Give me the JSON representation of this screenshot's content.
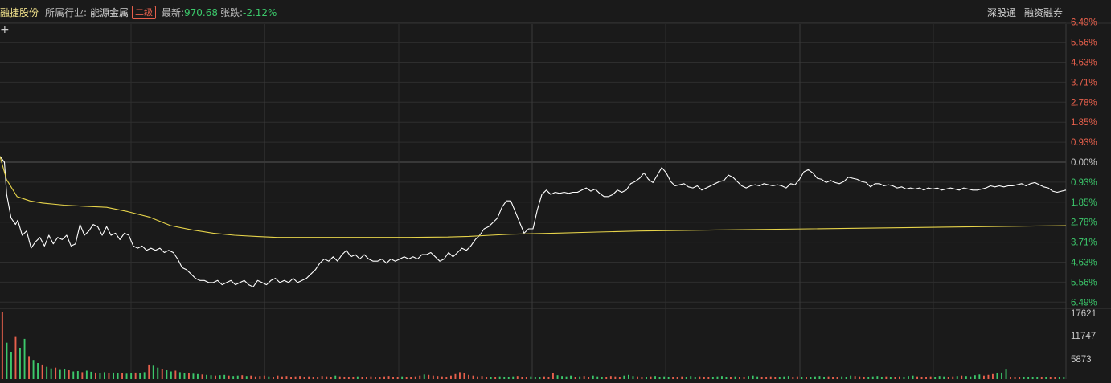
{
  "header": {
    "stock_name": "融捷股份",
    "industry_label": "所属行业:",
    "industry_value": "能源金属",
    "level_badge": "二级",
    "latest_label": "最新:",
    "latest_value": "970.68",
    "change_label": "张跌:",
    "change_value": "-2.12%",
    "link_1": "深股通",
    "link_2": "融资融券",
    "crosshair_icon": "+"
  },
  "colors": {
    "background": "#1a1a1a",
    "up": "#e8604c",
    "down": "#3cc86b",
    "neutral": "#c8c8c8",
    "price_line": "#ffffff",
    "avg_line": "#e6d34a",
    "grid": "#2e2e2e"
  },
  "chart_data": [
    {
      "type": "line",
      "y_axis_labels": [
        "6.49%",
        "5.56%",
        "4.63%",
        "3.71%",
        "2.78%",
        "1.85%",
        "0.93%",
        "0.00%",
        "0.93%",
        "1.85%",
        "2.78%",
        "3.71%",
        "4.63%",
        "5.56%",
        "6.49%"
      ],
      "ylim": [
        -6.49,
        6.49
      ],
      "x_range": [
        0,
        240
      ],
      "series": [
        {
          "role": "price",
          "color": "#ffffff",
          "points": [
            [
              0,
              0.27
            ],
            [
              2,
              0
            ],
            [
              3,
              -1.5
            ],
            [
              5,
              -2.6
            ],
            [
              7,
              -2.9
            ],
            [
              8,
              -2.7
            ],
            [
              10,
              -3.4
            ],
            [
              12,
              -3.2
            ],
            [
              14,
              -4.0
            ],
            [
              16,
              -3.7
            ],
            [
              18,
              -3.5
            ],
            [
              20,
              -3.9
            ],
            [
              22,
              -3.4
            ],
            [
              24,
              -3.8
            ],
            [
              26,
              -3.5
            ],
            [
              28,
              -3.6
            ],
            [
              30,
              -3.4
            ],
            [
              32,
              -3.9
            ],
            [
              34,
              -3.8
            ],
            [
              36,
              -2.9
            ],
            [
              38,
              -3.4
            ],
            [
              40,
              -3.2
            ],
            [
              42,
              -2.9
            ],
            [
              44,
              -3.0
            ],
            [
              46,
              -3.4
            ],
            [
              48,
              -3.0
            ],
            [
              50,
              -3.4
            ],
            [
              52,
              -3.3
            ],
            [
              54,
              -3.6
            ],
            [
              56,
              -3.3
            ],
            [
              58,
              -3.4
            ],
            [
              60,
              -3.9
            ],
            [
              62,
              -4.0
            ],
            [
              64,
              -3.9
            ],
            [
              66,
              -4.1
            ],
            [
              68,
              -4.0
            ],
            [
              70,
              -4.1
            ],
            [
              72,
              -4.0
            ],
            [
              74,
              -4.2
            ],
            [
              76,
              -4.1
            ],
            [
              78,
              -4.2
            ],
            [
              80,
              -4.5
            ],
            [
              82,
              -4.9
            ],
            [
              84,
              -5.0
            ],
            [
              86,
              -5.2
            ],
            [
              88,
              -5.4
            ],
            [
              90,
              -5.5
            ],
            [
              92,
              -5.5
            ],
            [
              94,
              -5.6
            ],
            [
              96,
              -5.6
            ],
            [
              98,
              -5.5
            ],
            [
              100,
              -5.7
            ],
            [
              102,
              -5.6
            ],
            [
              104,
              -5.5
            ],
            [
              106,
              -5.7
            ],
            [
              108,
              -5.6
            ],
            [
              110,
              -5.5
            ],
            [
              112,
              -5.7
            ],
            [
              114,
              -5.8
            ],
            [
              116,
              -5.5
            ],
            [
              118,
              -5.6
            ],
            [
              120,
              -5.7
            ],
            [
              122,
              -5.5
            ],
            [
              124,
              -5.4
            ],
            [
              126,
              -5.6
            ],
            [
              128,
              -5.5
            ],
            [
              130,
              -5.6
            ],
            [
              132,
              -5.4
            ],
            [
              134,
              -5.6
            ],
            [
              136,
              -5.5
            ],
            [
              138,
              -5.4
            ],
            [
              140,
              -5.2
            ],
            [
              142,
              -5.0
            ],
            [
              144,
              -4.7
            ],
            [
              146,
              -4.5
            ],
            [
              148,
              -4.6
            ],
            [
              150,
              -4.4
            ],
            [
              152,
              -4.6
            ],
            [
              154,
              -4.3
            ],
            [
              156,
              -4.1
            ],
            [
              158,
              -4.4
            ],
            [
              160,
              -4.3
            ],
            [
              162,
              -4.5
            ],
            [
              164,
              -4.3
            ],
            [
              166,
              -4.5
            ],
            [
              168,
              -4.6
            ],
            [
              170,
              -4.6
            ],
            [
              172,
              -4.5
            ],
            [
              174,
              -4.7
            ],
            [
              176,
              -4.5
            ],
            [
              178,
              -4.6
            ],
            [
              180,
              -4.5
            ],
            [
              182,
              -4.4
            ],
            [
              184,
              -4.5
            ],
            [
              186,
              -4.4
            ],
            [
              188,
              -4.5
            ],
            [
              190,
              -4.3
            ],
            [
              192,
              -4.3
            ],
            [
              194,
              -4.2
            ],
            [
              196,
              -4.4
            ],
            [
              198,
              -4.6
            ],
            [
              200,
              -4.5
            ],
            [
              202,
              -4.2
            ],
            [
              204,
              -4.4
            ],
            [
              206,
              -4.2
            ],
            [
              208,
              -4.0
            ],
            [
              210,
              -4.1
            ],
            [
              212,
              -3.9
            ],
            [
              214,
              -3.6
            ],
            [
              216,
              -3.4
            ],
            [
              218,
              -3.1
            ],
            [
              220,
              -3.0
            ],
            [
              222,
              -2.8
            ],
            [
              224,
              -2.6
            ],
            [
              226,
              -2.1
            ],
            [
              228,
              -1.8
            ],
            [
              230,
              -1.8
            ],
            [
              232,
              -2.3
            ],
            [
              234,
              -2.8
            ],
            [
              236,
              -3.3
            ],
            [
              238,
              -3.1
            ],
            [
              240,
              -3.1
            ]
          ],
          "note_points_scaled": false
        },
        {
          "role": "average",
          "color": "#e6d34a",
          "points": [
            [
              0,
              0.27
            ],
            [
              3,
              -0.8
            ],
            [
              8,
              -1.6
            ],
            [
              14,
              -1.8
            ],
            [
              20,
              -1.9
            ],
            [
              30,
              -2.0
            ],
            [
              40,
              -2.05
            ],
            [
              50,
              -2.1
            ],
            [
              60,
              -2.3
            ],
            [
              70,
              -2.55
            ],
            [
              80,
              -2.95
            ],
            [
              90,
              -3.15
            ],
            [
              100,
              -3.3
            ],
            [
              110,
              -3.4
            ],
            [
              120,
              -3.45
            ],
            [
              130,
              -3.5
            ],
            [
              140,
              -3.5
            ],
            [
              150,
              -3.5
            ],
            [
              160,
              -3.5
            ],
            [
              170,
              -3.5
            ],
            [
              180,
              -3.5
            ],
            [
              190,
              -3.5
            ],
            [
              200,
              -3.49
            ],
            [
              210,
              -3.48
            ],
            [
              220,
              -3.45
            ],
            [
              230,
              -3.4
            ],
            [
              240,
              -3.35
            ],
            [
              260,
              -3.3
            ],
            [
              280,
              -3.25
            ],
            [
              300,
              -3.2
            ],
            [
              340,
              -3.15
            ],
            [
              380,
              -3.1
            ],
            [
              420,
              -3.05
            ],
            [
              460,
              -3.0
            ],
            [
              500,
              -2.95
            ]
          ]
        }
      ]
    },
    {
      "type": "bar",
      "y_axis_labels": [
        "17621",
        "11747",
        "5873"
      ],
      "ylim": [
        0,
        17621
      ],
      "series": [
        {
          "role": "volume"
        }
      ]
    }
  ]
}
